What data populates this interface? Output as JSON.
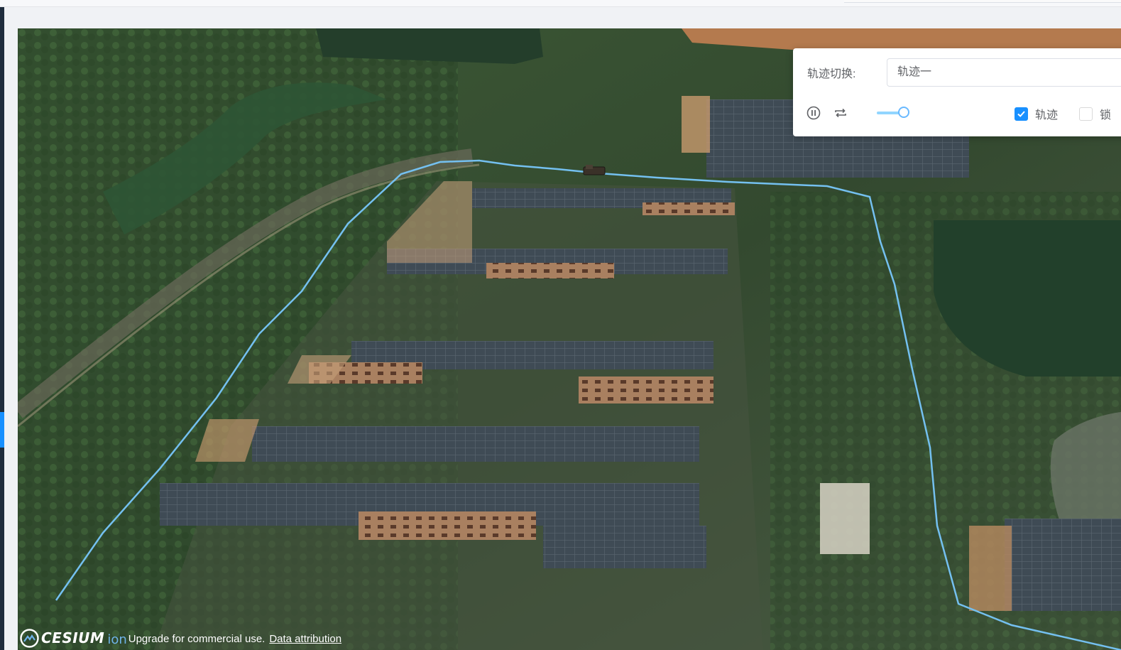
{
  "panel": {
    "track_label": "轨迹切换:",
    "track_selected": "轨迹一",
    "speed_fraction": 0.2,
    "checkbox_track": {
      "label": "轨迹",
      "checked": true
    },
    "checkbox_lock": {
      "label": "锁",
      "checked": false
    },
    "icons": [
      "pause-circle-icon",
      "loop-icon"
    ]
  },
  "credits": {
    "logo_text": "CESIUM",
    "logo_suffix": "ion",
    "upgrade_text": "Upgrade for commercial use.",
    "attribution_link": "Data attribution"
  },
  "colors": {
    "accent": "#1890ff",
    "track_path": "#74c0f0",
    "slider_fill": "#91d5ff"
  }
}
